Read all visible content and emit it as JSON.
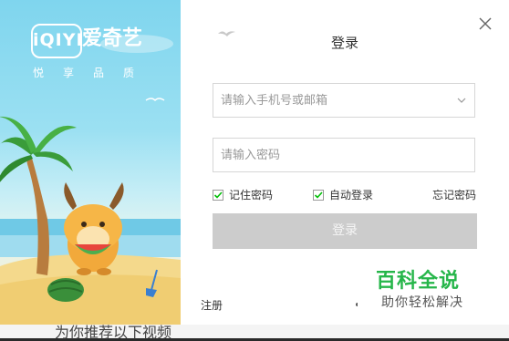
{
  "background": {
    "bottom_text": "为你推荐以下视频"
  },
  "brand": {
    "logo_text": "iQIYI",
    "name": "爱奇艺",
    "tagline": "悦享品质"
  },
  "dialog": {
    "title": "登录",
    "phone_placeholder": "请输入手机号或邮箱",
    "password_placeholder": "请输入密码",
    "remember_label": "记住密码",
    "auto_login_label": "自动登录",
    "forgot_label": "忘记密码",
    "login_label": "登录",
    "register_label": "注册",
    "remember_checked": true,
    "auto_login_checked": true
  },
  "watermark": {
    "title": "百科全说",
    "subtitle": "助你轻松解决"
  },
  "colors": {
    "brand_green": "#00be06",
    "watermark_green": "#26b64a",
    "button_disabled": "#cccccc"
  },
  "icons": [
    "close-icon",
    "chevron-down-icon",
    "checkmark-icon",
    "bird-icon"
  ]
}
